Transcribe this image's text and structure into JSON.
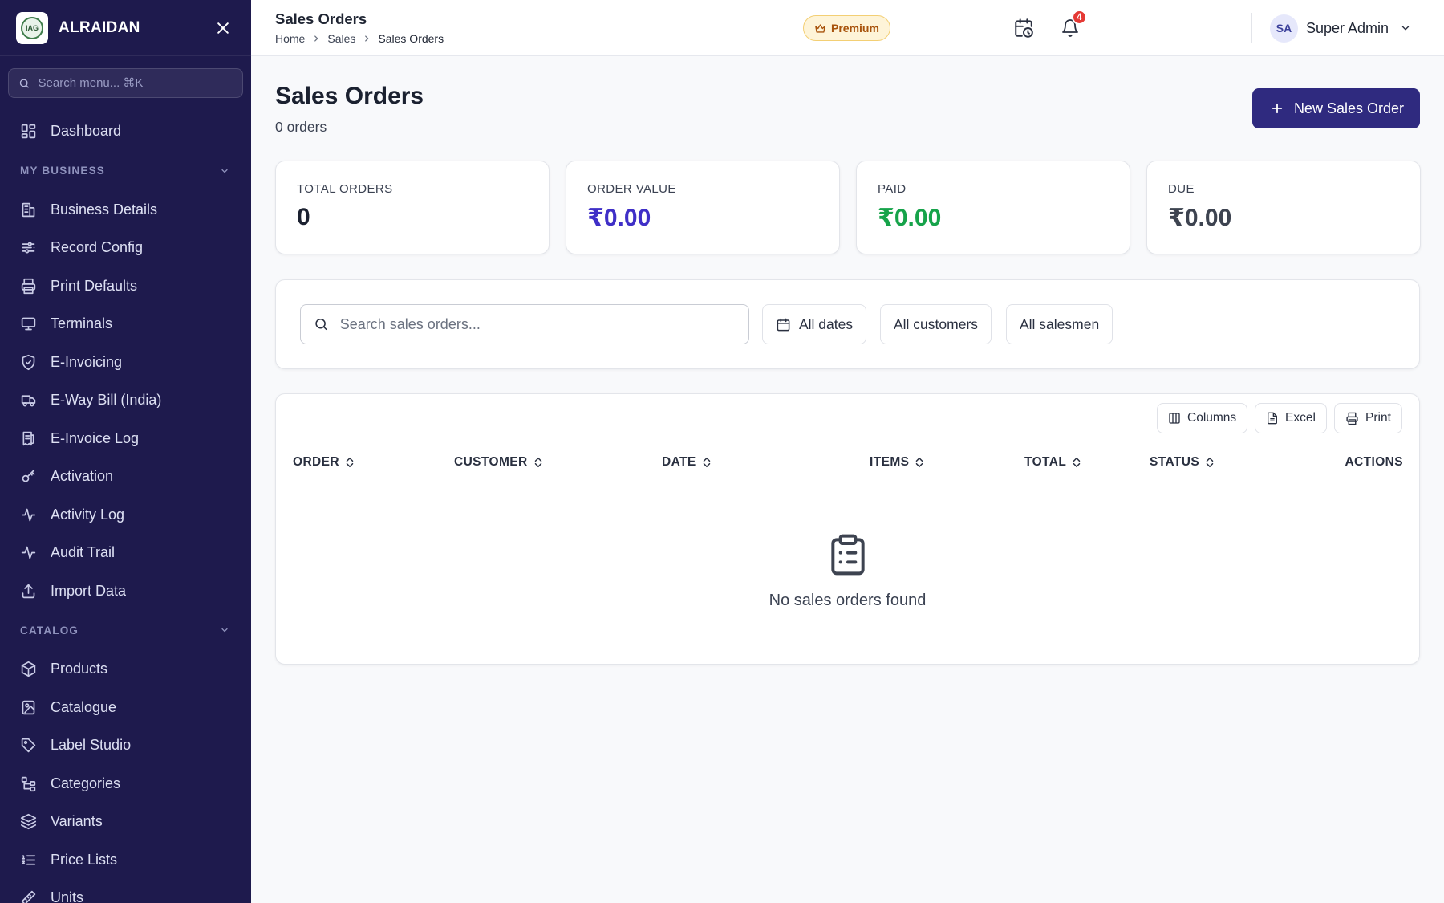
{
  "sidebar": {
    "brand": {
      "name": "ALRAIDAN",
      "logo_text": "IAG"
    },
    "search_placeholder": "Search menu... ⌘K",
    "dashboard": {
      "label": "Dashboard",
      "icon": "dashboard-icon"
    },
    "sections": [
      {
        "title": "MY BUSINESS",
        "items": [
          {
            "label": "Business Details",
            "icon": "building-icon"
          },
          {
            "label": "Record Config",
            "icon": "sliders-icon"
          },
          {
            "label": "Print Defaults",
            "icon": "printer-icon"
          },
          {
            "label": "Terminals",
            "icon": "monitor-icon"
          },
          {
            "label": "E-Invoicing",
            "icon": "shield-check-icon"
          },
          {
            "label": "E-Way Bill (India)",
            "icon": "truck-icon"
          },
          {
            "label": "E-Invoice Log",
            "icon": "receipt-icon"
          },
          {
            "label": "Activation",
            "icon": "key-icon"
          },
          {
            "label": "Activity Log",
            "icon": "activity-icon"
          },
          {
            "label": "Audit Trail",
            "icon": "activity-icon"
          },
          {
            "label": "Import Data",
            "icon": "upload-icon"
          }
        ]
      },
      {
        "title": "CATALOG",
        "items": [
          {
            "label": "Products",
            "icon": "box-icon"
          },
          {
            "label": "Catalogue",
            "icon": "image-book-icon"
          },
          {
            "label": "Label Studio",
            "icon": "tag-icon"
          },
          {
            "label": "Categories",
            "icon": "tree-icon"
          },
          {
            "label": "Variants",
            "icon": "layers-icon"
          },
          {
            "label": "Price Lists",
            "icon": "list-ordered-icon"
          },
          {
            "label": "Units",
            "icon": "ruler-icon"
          }
        ]
      }
    ]
  },
  "header": {
    "title": "Sales Orders",
    "breadcrumb": [
      "Home",
      "Sales",
      "Sales Orders"
    ],
    "premium_label": "Premium",
    "notifications_count": "4",
    "user": {
      "initials": "SA",
      "name": "Super Admin"
    }
  },
  "page": {
    "title": "Sales Orders",
    "subtitle": "0 orders",
    "new_button_label": "New Sales Order"
  },
  "stats": [
    {
      "label": "TOTAL ORDERS",
      "value": "0",
      "color": "#1b2130"
    },
    {
      "label": "ORDER VALUE",
      "value": "₹0.00",
      "color": "#3f2fc7"
    },
    {
      "label": "PAID",
      "value": "₹0.00",
      "color": "#16a34a"
    },
    {
      "label": "DUE",
      "value": "₹0.00",
      "color": "#3d4350"
    }
  ],
  "filters": {
    "search_placeholder": "Search sales orders...",
    "dates": "All dates",
    "customers": "All customers",
    "salesmen": "All salesmen"
  },
  "table": {
    "toolbar": {
      "columns": "Columns",
      "excel": "Excel",
      "print": "Print"
    },
    "columns": [
      "ORDER",
      "CUSTOMER",
      "DATE",
      "ITEMS",
      "TOTAL",
      "STATUS",
      "ACTIONS"
    ],
    "rows": [],
    "empty_text": "No sales orders found"
  },
  "colors": {
    "sidebar_bg": "#1e1a4d",
    "primary": "#2f2a7f",
    "accent_purple": "#3f2fc7",
    "accent_green": "#16a34a",
    "badge_red": "#e53935"
  }
}
